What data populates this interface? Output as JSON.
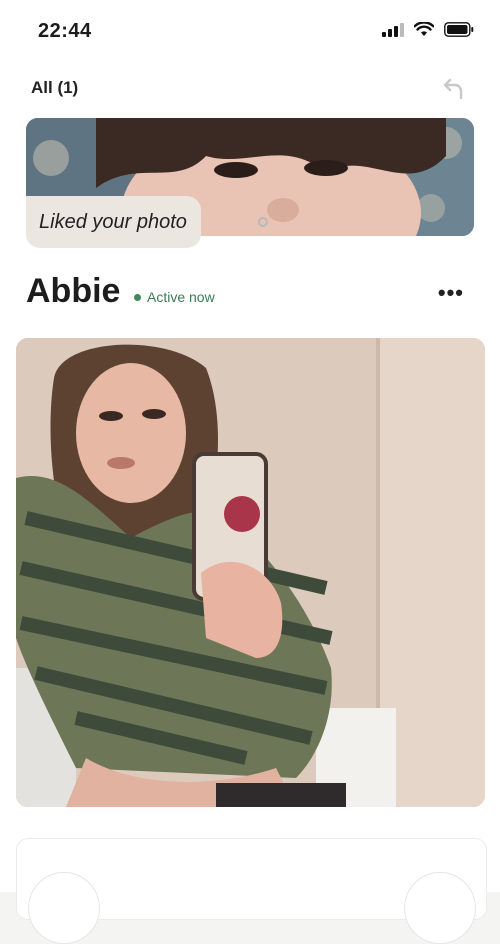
{
  "status": {
    "time": "22:44"
  },
  "header": {
    "filter_label": "All (1)"
  },
  "liked": {
    "caption": "Liked your photo"
  },
  "profile": {
    "name": "Abbie",
    "active_status": "Active now",
    "more_label": "•••"
  }
}
